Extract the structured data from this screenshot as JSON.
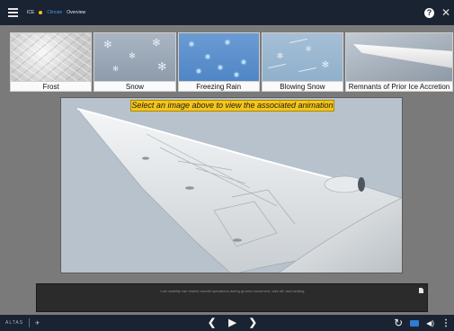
{
  "header": {
    "crumbs": [
      "ICE",
      "Climate",
      "Overview"
    ]
  },
  "thumbnails": [
    {
      "label": "Frost"
    },
    {
      "label": "Snow"
    },
    {
      "label": "Freezing Rain"
    },
    {
      "label": "Blowing Snow"
    },
    {
      "label": "Remnants of Prior Ice Accretion"
    }
  ],
  "viewer": {
    "banner": "Select an image above to view the associated animation"
  },
  "caption": {
    "text": "Low visibility can restrict aircraft operations during ground movement, take off, and landing."
  },
  "footer": {
    "logo_text": "ALTAS"
  },
  "colors": {
    "bar": "#1a2331",
    "banner": "#f5c518",
    "accent": "#2f7bd6"
  },
  "icons": [
    "menu-icon",
    "help-icon",
    "close-icon",
    "prev-icon",
    "play-icon",
    "next-icon",
    "reload-icon",
    "captions-icon",
    "volume-icon",
    "more-icon",
    "document-icon"
  ]
}
